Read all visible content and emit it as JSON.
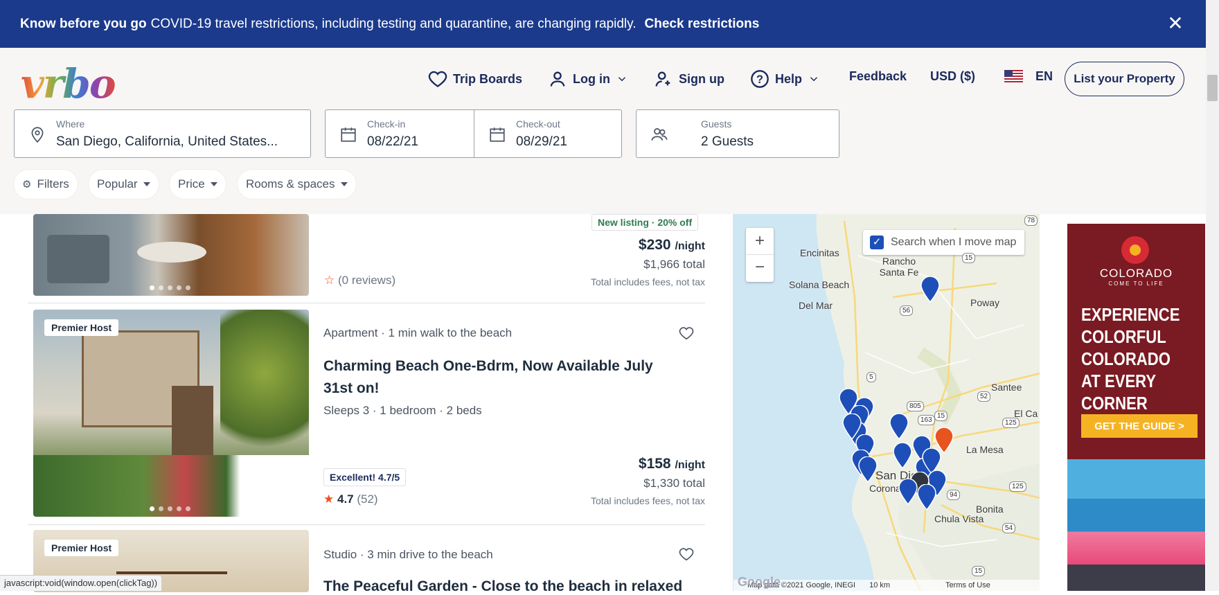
{
  "banner": {
    "bold_lead": "Know before you go",
    "message": "COVID-19 travel restrictions, including testing and quarantine, are changing rapidly.",
    "link": "Check restrictions",
    "close_icon": "close-icon"
  },
  "header": {
    "logo": "vrbo",
    "nav": {
      "trip_boards": "Trip Boards",
      "log_in": "Log in",
      "sign_up": "Sign up",
      "help": "Help",
      "feedback": "Feedback",
      "currency": "USD ($)",
      "language": "EN",
      "list_property": "List your Property"
    }
  },
  "search": {
    "where_label": "Where",
    "where_value": "San Diego, California, United States...",
    "checkin_label": "Check-in",
    "checkin_value": "08/22/21",
    "checkout_label": "Check-out",
    "checkout_value": "08/29/21",
    "guests_label": "Guests",
    "guests_value": "2 Guests"
  },
  "filters": {
    "filters": "Filters",
    "popular": "Popular",
    "price": "Price",
    "rooms": "Rooms & spaces"
  },
  "listings": [
    {
      "badge": "New listing · 20% off",
      "price": "$230",
      "per_night": "/night",
      "total": "$1,966 total",
      "note": "Total includes fees, not tax",
      "reviews": "(0 reviews)"
    },
    {
      "host_badge": "Premier Host",
      "meta": "Apartment · 1 min walk to the beach",
      "title": "Charming Beach One-Bdrm, Now Available July 31st on!",
      "details": "Sleeps 3 · 1 bedroom · 2 beds",
      "rating_badge": "Excellent! 4.7/5",
      "rating": "4.7",
      "review_count": "(52)",
      "price": "$158",
      "per_night": "/night",
      "total": "$1,330 total",
      "note": "Total includes fees, not tax"
    },
    {
      "host_badge": "Premier Host",
      "meta": "Studio · 3 min drive to the beach",
      "title": "The Peaceful Garden - Close to the beach in relaxed"
    }
  ],
  "map": {
    "zoom_in": "+",
    "zoom_out": "−",
    "search_move": "Search when I move map",
    "search_move_checked": true,
    "places": [
      "Encinitas",
      "Rancho Santa Fe",
      "Solana Beach",
      "Del Mar",
      "Poway",
      "Santee",
      "El Ca",
      "La Mesa",
      "San Diego",
      "Coronado",
      "Bonita",
      "Chula Vista"
    ],
    "footer_data": "Map data ©2021 Google, INEGI",
    "scale": "10 km",
    "terms": "Terms of Use",
    "google": "Google",
    "highway_labels": [
      "78",
      "15",
      "56",
      "5",
      "805",
      "15",
      "52",
      "163",
      "125",
      "94",
      "125",
      "54",
      "15"
    ]
  },
  "ad": {
    "brand": "COLORADO",
    "tagline": "COME TO LIFE",
    "headline": "EXPERIENCE COLORFUL COLORADO AT EVERY CORNER",
    "cta": "GET THE GUIDE >"
  },
  "status_bar": "javascript:void(window.open(clickTag))",
  "colors": {
    "banner": "#1b3a8c",
    "brand_navy": "#1b2a5c",
    "pin_blue": "#1e4fb8",
    "pin_selected": "#e8541e",
    "ad_bg": "#7a1a22"
  }
}
